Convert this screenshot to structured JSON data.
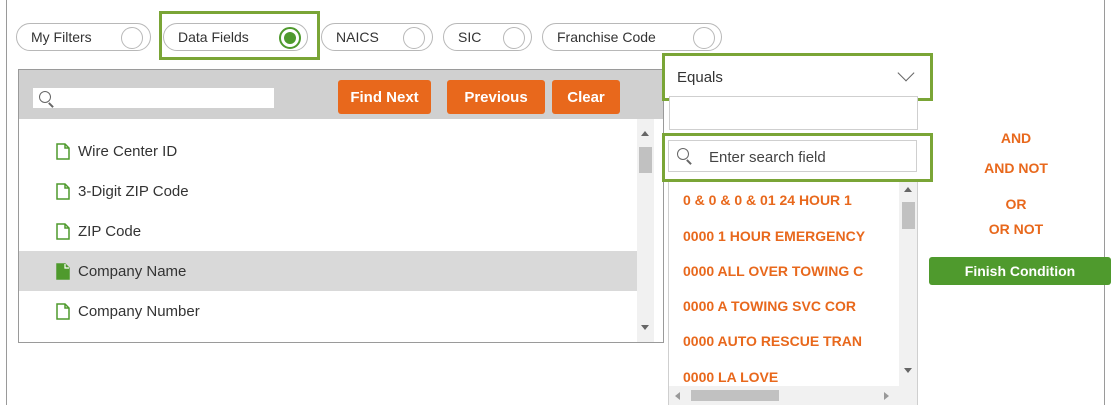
{
  "filter_tabs": [
    {
      "label": "My Filters",
      "selected": false
    },
    {
      "label": "Data Fields",
      "selected": true
    },
    {
      "label": "NAICS",
      "selected": false
    },
    {
      "label": "SIC",
      "selected": false
    },
    {
      "label": "Franchise Code",
      "selected": false
    }
  ],
  "field_panel": {
    "search": {
      "value": "",
      "placeholder": ""
    },
    "buttons": {
      "find_next": "Find Next",
      "previous": "Previous",
      "clear": "Clear"
    },
    "items": [
      {
        "label": "Wire Center ID",
        "selected": false
      },
      {
        "label": "3-Digit ZIP Code",
        "selected": false
      },
      {
        "label": "ZIP Code",
        "selected": false
      },
      {
        "label": "Company Name",
        "selected": true
      },
      {
        "label": "Company Number",
        "selected": false
      }
    ]
  },
  "operator": {
    "selected": "Equals"
  },
  "value_input": {
    "value": ""
  },
  "value_search": {
    "placeholder": "Enter search field"
  },
  "values": [
    "0 & 0 & 0 & 01 24 HOUR 1",
    "0000 1 HOUR EMERGENCY",
    "0000 ALL OVER TOWING C",
    "0000 A TOWING SVC COR",
    "0000 AUTO RESCUE TRAN",
    "0000 LA LOVE"
  ],
  "logic": {
    "and": "AND",
    "and_not": "AND NOT",
    "or": "OR",
    "or_not": "OR NOT",
    "finish": "Finish Condition"
  },
  "colors": {
    "accent_orange": "#e8681c",
    "accent_green": "#4f9a2d",
    "highlight": "#7aa536"
  },
  "icons": {
    "field_item": "document-icon",
    "selected_field_item": "document-filled-icon",
    "search": "search-icon",
    "dropdown": "chevron-down-icon"
  }
}
